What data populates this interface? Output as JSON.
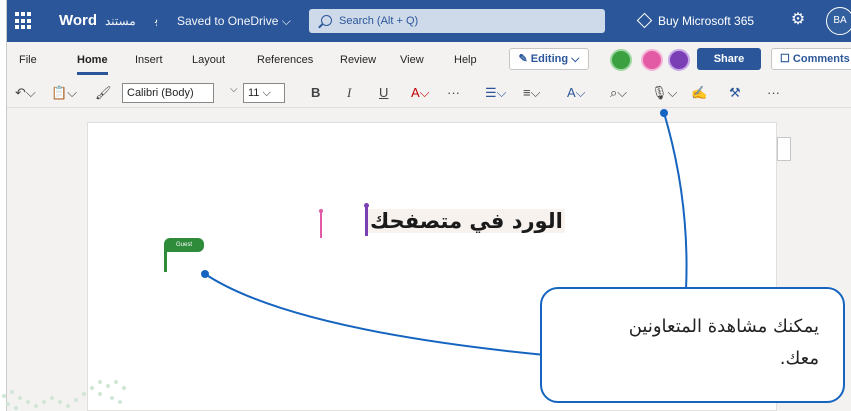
{
  "titlebar": {
    "app_name": "Word",
    "document_name": "مستند",
    "coauthor_glyph": "ﭔ",
    "save_status": "Saved to OneDrive ⌵",
    "search_placeholder": "Search (Alt + Q)",
    "buy_label": "Buy Microsoft 365",
    "settings_glyph": "⚙",
    "user_initials": "BA"
  },
  "menu": {
    "items": [
      "File",
      "Home",
      "Insert",
      "Layout",
      "References",
      "Review",
      "View",
      "Help"
    ],
    "editing_label": "✎ Editing ⌵",
    "share_label": "Share",
    "comments_label": "☐ Comments",
    "coauthor_colors": [
      "#3aa040",
      "#e35ba4",
      "#7a3fb5"
    ]
  },
  "toolbar": {
    "undo_glyph": "↶⌵",
    "clipboard_glyph": "📋⌵",
    "format_painter_glyph": "🖌",
    "font_name": "Calibri (Body)",
    "font_drop_glyph": "⌵",
    "font_size": "11 ⌵",
    "bold": "B",
    "italic": "I",
    "underline": "U",
    "font_color": "A⌵",
    "more": "···",
    "bullets": "☰⌵",
    "align": "≡⌵",
    "styles": "A⌵",
    "find": "⌕⌵",
    "dictate": "🎙⌵",
    "editor": "✍",
    "designer": "⚒",
    "more2": "···"
  },
  "document": {
    "text": "الورد في متصفحك",
    "guest_label": "Guest"
  },
  "callout": {
    "text_line1": "يمكنك مشاهدة المتعاونين",
    "text_line2": "معك.",
    "border_color": "#1565c0"
  }
}
